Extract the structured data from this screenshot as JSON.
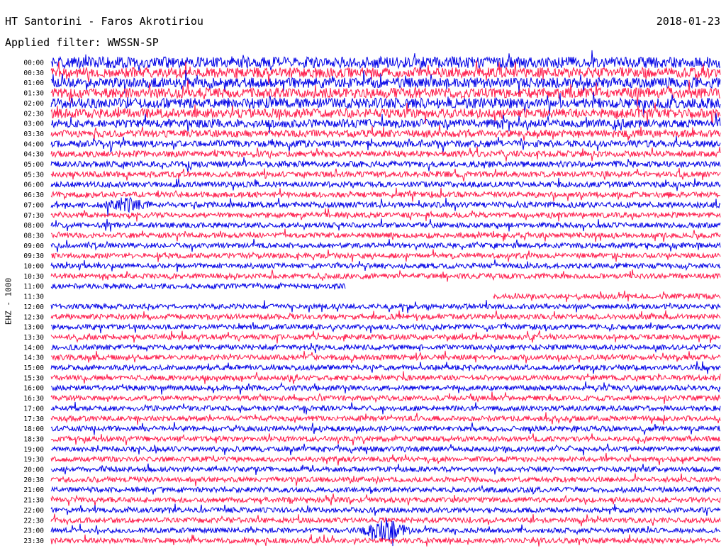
{
  "header": {
    "station_title": "HT Santorini - Faros Akrotiriou",
    "date": "2018-01-23",
    "filter": "Applied filter: WWSSN-SP"
  },
  "channel_label": "EHZ - 1000",
  "colors": {
    "trace_a": "#0000e6",
    "trace_b": "#ff1a4a",
    "background": "#ffffff",
    "text": "#000000"
  },
  "chart_data": {
    "type": "line",
    "title": "HT Santorini - Faros Akrotiriou",
    "xlabel": "",
    "ylabel": "EHZ - 1000",
    "grid": false,
    "legend": "none",
    "row_labels": [
      "00:00",
      "00:30",
      "01:00",
      "01:30",
      "02:00",
      "02:30",
      "03:00",
      "03:30",
      "04:00",
      "04:30",
      "05:00",
      "05:30",
      "06:00",
      "06:30",
      "07:00",
      "07:30",
      "08:00",
      "08:30",
      "09:00",
      "09:30",
      "10:00",
      "10:30",
      "11:00",
      "11:30",
      "12:00",
      "12:30",
      "13:00",
      "13:30",
      "14:00",
      "14:30",
      "15:00",
      "15:30",
      "16:00",
      "16:30",
      "17:00",
      "17:30",
      "18:00",
      "18:30",
      "19:00",
      "19:30",
      "20:00",
      "20:30",
      "21:00",
      "21:30",
      "22:00",
      "22:30",
      "23:00",
      "23:30"
    ],
    "row_colors": [
      "trace_a",
      "trace_b"
    ],
    "relative_amplitude": [
      2.2,
      2.0,
      2.0,
      2.0,
      2.0,
      1.8,
      1.6,
      1.4,
      1.3,
      1.2,
      1.2,
      1.1,
      1.1,
      1.1,
      1.1,
      1.0,
      1.0,
      1.0,
      1.0,
      1.0,
      1.0,
      1.0,
      1.0,
      1.0,
      1.0,
      1.0,
      1.0,
      1.0,
      1.0,
      1.0,
      1.0,
      1.0,
      1.0,
      1.0,
      1.0,
      1.0,
      1.0,
      1.0,
      1.0,
      1.0,
      1.0,
      1.0,
      1.0,
      1.0,
      1.0,
      1.0,
      1.0,
      1.0
    ],
    "data_gap": {
      "row_start": "11:00",
      "start_fraction": 0.44,
      "row_end": "11:30",
      "end_fraction": 0.66
    },
    "events": [
      {
        "row": "07:00",
        "fraction": 0.11,
        "strength": 2.0
      },
      {
        "row": "23:00",
        "fraction": 0.5,
        "strength": 4.0
      }
    ]
  }
}
